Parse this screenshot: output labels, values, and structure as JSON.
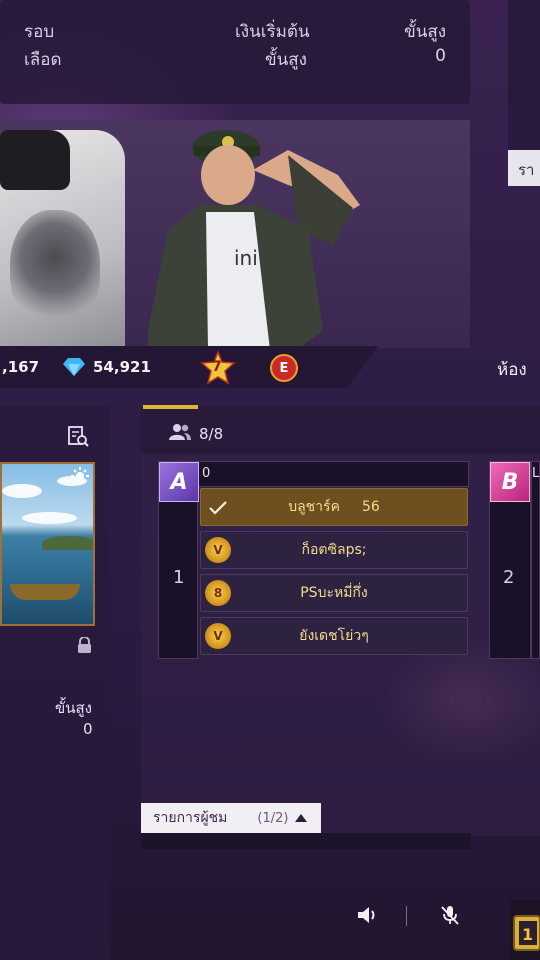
{
  "top_panel": {
    "label_round": "รอบ",
    "label_blood": "เลือด",
    "label_start": "เงินเริ่มต้น",
    "label_max_level": "ขั้นสูง",
    "label_max_level_2": "ขั้นสูง",
    "max_level_value": "0"
  },
  "right_edge_tab": "รา",
  "currency": {
    "coins": ",167",
    "diamonds": "54,921",
    "rank_badge_value": "7",
    "elite_badge": "E",
    "room_label": "ห้อง"
  },
  "left_panel": {
    "max_level_label": "ขั้นสูง",
    "max_level_value": "0"
  },
  "lobby": {
    "players_count": "8/8",
    "team1": {
      "logo": "A",
      "number": "1",
      "name_header": "0",
      "players": [
        {
          "name": "บลูชาร์ค",
          "level": "56",
          "selected": true,
          "badge": ""
        },
        {
          "name": "ก็อตซิลps;",
          "badge": "V"
        },
        {
          "name": "PSบะหมี่กึ่ง",
          "badge": "8"
        },
        {
          "name": "ยังเดชโย่วๆ",
          "badge": "V"
        }
      ]
    },
    "team2": {
      "logo": "B",
      "number": "2",
      "name_header": "L"
    }
  },
  "spectator": {
    "label": "รายการผู้ชม",
    "page": "(1/2)"
  },
  "colors": {
    "gold": "#e0b437",
    "slot_active": "#6e5020",
    "team1_logo": "#7d55c8",
    "team2_logo": "#d44a9a"
  }
}
